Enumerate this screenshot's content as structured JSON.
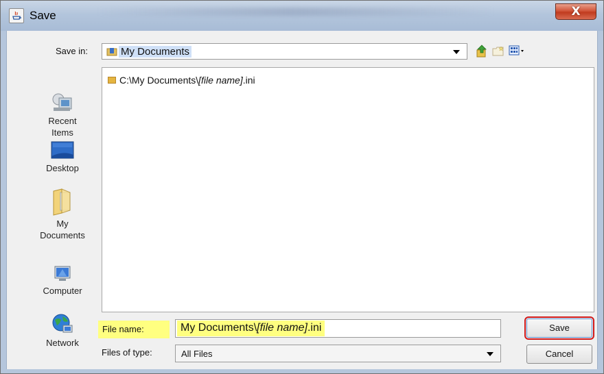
{
  "window": {
    "title": "Save",
    "close_glyph": "X"
  },
  "save_in": {
    "label": "Save in:",
    "value": "My Documents"
  },
  "toolbar": {
    "icons": [
      "up-one-level-icon",
      "new-folder-icon",
      "view-menu-icon"
    ]
  },
  "places": [
    {
      "label_line1": "Recent",
      "label_line2": "Items",
      "icon": "recent-items-icon"
    },
    {
      "label_line1": "Desktop",
      "label_line2": "",
      "icon": "desktop-icon"
    },
    {
      "label_line1": "My",
      "label_line2": "Documents",
      "icon": "my-documents-icon"
    },
    {
      "label_line1": "Computer",
      "label_line2": "",
      "icon": "computer-icon"
    },
    {
      "label_line1": "Network",
      "label_line2": "",
      "icon": "network-icon"
    }
  ],
  "file_list": {
    "entries": [
      {
        "prefix": "C:\\My Documents\\",
        "italic": "[file name]",
        "suffix": ".ini"
      }
    ]
  },
  "file_name": {
    "label": "File name:",
    "prefix": "My Documents\\",
    "italic": "[file name]",
    "suffix": ".ini"
  },
  "file_type": {
    "label": "Files of type:",
    "value": "All Files"
  },
  "buttons": {
    "save": "Save",
    "cancel": "Cancel"
  },
  "colors": {
    "highlight": "#ffff80",
    "save_button_outline": "#d01818",
    "title_bar": "#b3c5dc"
  }
}
